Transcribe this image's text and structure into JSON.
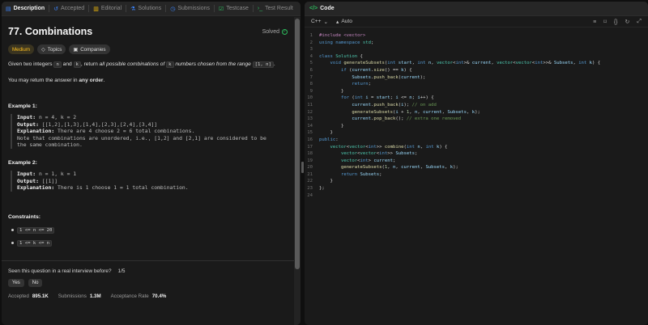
{
  "left_tabs": [
    {
      "label": "Description",
      "icon": "document-icon",
      "active": true
    },
    {
      "label": "Accepted",
      "icon": "history-icon",
      "active": false
    },
    {
      "label": "Editorial",
      "icon": "book-icon",
      "active": false
    },
    {
      "label": "Solutions",
      "icon": "flask-icon",
      "active": false
    },
    {
      "label": "Submissions",
      "icon": "clock-icon",
      "active": false
    },
    {
      "label": "Testcase",
      "icon": "checkbox-icon",
      "active": false
    },
    {
      "label": "Test Result",
      "icon": "terminal-icon",
      "active": false
    }
  ],
  "problem": {
    "title": "77. Combinations",
    "status": "Solved",
    "difficulty": "Medium",
    "tags": [
      "Topics",
      "Companies"
    ],
    "desc_1": "Given two integers",
    "var_n": "n",
    "desc_2": "and",
    "var_k": "k",
    "desc_3": ", return",
    "desc_em": "all possible combinations of",
    "var_k2": "k",
    "desc_em2": "numbers chosen from the range",
    "range": "[1, n]",
    "desc_end": ".",
    "desc_para2_a": "You may return the answer in",
    "desc_para2_b": "any order",
    "desc_para2_c": "."
  },
  "examples": [
    {
      "title": "Example 1:",
      "input_label": "Input:",
      "input": "n = 4, k = 2",
      "output_label": "Output:",
      "output": "[[1,2],[1,3],[1,4],[2,3],[2,4],[3,4]]",
      "explanation_label": "Explanation:",
      "explanation": "There are 4 choose 2 = 6 total combinations.",
      "note_1": "Note that combinations are unordered, i.e., [1,2] and [2,1] are considered to be",
      "note_2": "the same combination."
    },
    {
      "title": "Example 2:",
      "input_label": "Input:",
      "input": "n = 1, k = 1",
      "output_label": "Output:",
      "output": "[[1]]",
      "explanation_label": "Explanation:",
      "explanation": "There is 1 choose 1 = 1 total combination."
    }
  ],
  "constraints": {
    "title": "Constraints:",
    "items": [
      "1 <= n <= 20",
      "1 <= k <= n"
    ]
  },
  "footer": {
    "interview_question": "Seen this question in a real interview before?",
    "interview_count": "1/5",
    "yes": "Yes",
    "no": "No",
    "accepted_label": "Accepted",
    "accepted_value": "895.1K",
    "submissions_label": "Submissions",
    "submissions_value": "1.3M",
    "rate_label": "Acceptance Rate",
    "rate_value": "70.4%"
  },
  "code_panel": {
    "tab_label": "Code",
    "language": "C++",
    "mode": "Auto"
  },
  "code_lines": [
    "#include <vector>",
    "using namespace std;",
    "",
    "class Solution {",
    "    void generateSubsets(int start, int n, vector<int>& current, vector<vector<int>>& Subsets, int k) {",
    "        if (current.size() == k) {",
    "            Subsets.push_back(current);",
    "            return;",
    "        }",
    "        for (int i = start; i <= n; i++) {",
    "            current.push_back(i); // on add",
    "            generateSubsets(i + 1, n, current, Subsets, k);",
    "            current.pop_back(); // extra one removed",
    "        }",
    "    }",
    "public:",
    "    vector<vector<int>> combine(int n, int k) {",
    "        vector<vector<int>> Subsets;",
    "        vector<int> current;",
    "        generateSubsets(1, n, current, Subsets, k);",
    "        return Subsets;",
    "    }",
    "};",
    ""
  ]
}
